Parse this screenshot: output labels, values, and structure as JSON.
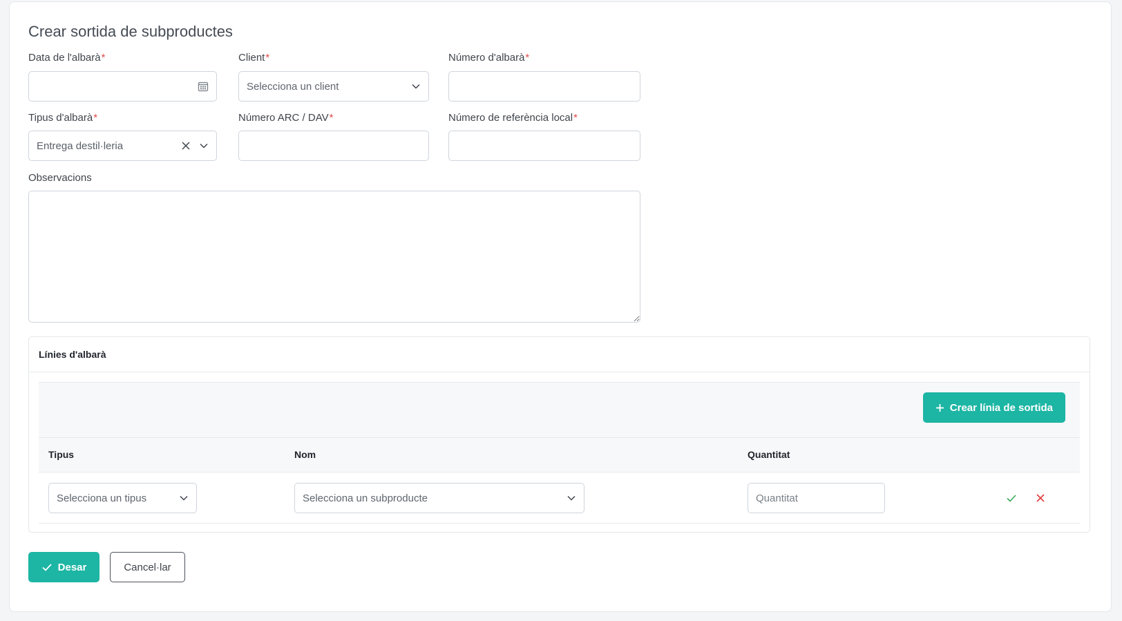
{
  "form": {
    "title": "Crear sortida de subproductes",
    "fields": {
      "data_albara": {
        "label": "Data de l'albarà",
        "required_mark": "*",
        "value": ""
      },
      "client": {
        "label": "Client",
        "required_mark": "*",
        "placeholder": "Selecciona un client"
      },
      "numero_albara": {
        "label": "Número d'albarà",
        "required_mark": "*",
        "value": ""
      },
      "tipus_albara": {
        "label": "Tipus d'albarà",
        "required_mark": "*",
        "value": "Entrega destil·leria"
      },
      "numero_arc": {
        "label": "Número ARC / DAV",
        "required_mark": "*",
        "value": ""
      },
      "numero_ref": {
        "label": "Número de referència local",
        "required_mark": "*",
        "value": ""
      },
      "observacions": {
        "label": "Observacions",
        "value": ""
      }
    }
  },
  "lines": {
    "title": "Línies d'albarà",
    "create_button": "Crear línia de sortida",
    "columns": [
      "Tipus",
      "Nom",
      "Quantitat"
    ],
    "row": {
      "tipus_placeholder": "Selecciona un tipus",
      "nom_placeholder": "Selecciona un subproducte",
      "quantitat_placeholder": "Quantitat"
    }
  },
  "actions": {
    "save": "Desar",
    "cancel": "Cancel·lar"
  },
  "colors": {
    "accent": "#1db5a4",
    "required": "#e24b4b",
    "confirm": "#3aa757",
    "delete": "#e03b3b"
  },
  "icons": {
    "calendar": "calendar-icon",
    "chevron": "chevron-down-icon",
    "clear": "close-icon",
    "plus": "plus-icon",
    "check": "check-icon"
  }
}
